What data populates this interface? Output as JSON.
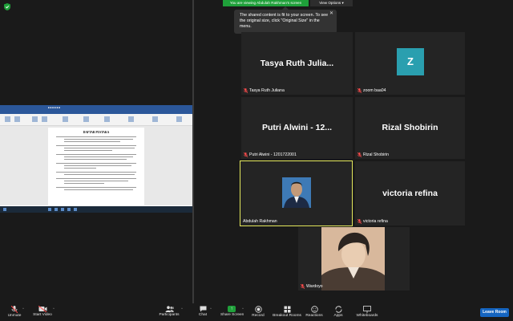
{
  "top_bar": {
    "viewing_banner": "You are viewing Abdulah Rakhman's screen",
    "view_options": "View Options ▾",
    "tooltip": "The shared content is fit to your screen. To see the original size, click \"Original Size\" in the menu."
  },
  "shared_screen": {
    "doc_heading": "DAFTAR PUSTAKA"
  },
  "participants": [
    {
      "big_name": "Tasya Ruth Julia...",
      "label": "Tasya Ruth Juliana"
    },
    {
      "initial": "Z",
      "label": "zoom baa04"
    },
    {
      "big_name": "Putri Alwini - 12...",
      "label": "Putri Alwini - 1201722001"
    },
    {
      "big_name": "Rizal Shobirin",
      "label": "Rizal Shobirin"
    },
    {
      "label": "Abdulah Rakhman"
    },
    {
      "big_name": "victoria refina",
      "label": "victoria refina"
    },
    {
      "label": "Wardoyo"
    }
  ],
  "toolbar": {
    "unmute": "Unmute",
    "start_video": "Start Video",
    "participants": "Participants",
    "participants_count": "8",
    "chat": "Chat",
    "share_screen": "Share Screen",
    "record": "Record",
    "breakout_rooms": "Breakout Rooms",
    "reactions": "Reactions",
    "apps": "Apps",
    "whiteboards": "Whiteboards",
    "leave_room": "Leave Room"
  },
  "colors": {
    "background": "#1a1a1a",
    "tile": "#242424",
    "banner_green": "#1fa03a",
    "active_speaker": "#e4e85c",
    "avatar_teal": "#2a9faf",
    "leave_blue": "#1565c0"
  }
}
